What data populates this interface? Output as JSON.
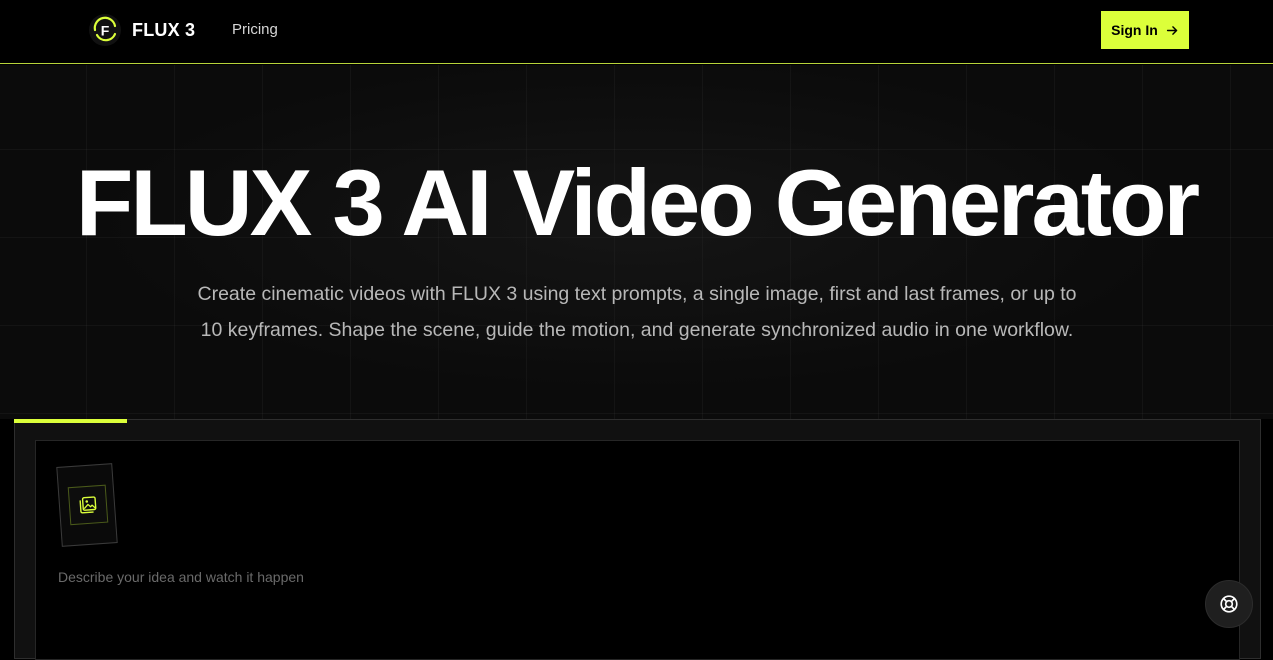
{
  "header": {
    "brand": "FLUX 3",
    "logo_letter": "F",
    "nav": {
      "pricing": "Pricing"
    },
    "signin_label": "Sign In"
  },
  "hero": {
    "title": "FLUX 3 AI Video Generator",
    "subtitle": "Create cinematic videos with FLUX 3 using text prompts, a single image, first and last frames, or up to 10 keyframes. Shape the scene, guide the motion, and generate synchronized audio in one workflow."
  },
  "composer": {
    "prompt_placeholder": "Describe your idea and watch it happen",
    "prompt_value": "",
    "upload_icon": "image-upload-icon"
  },
  "support": {
    "icon": "lifebuoy-icon"
  },
  "colors": {
    "accent": "#dcff3a",
    "background": "#000000",
    "hero_bg": "#0b0b0b",
    "panel_bg": "#111111",
    "text_muted": "#b8b8b8",
    "placeholder": "#6a6a6a"
  }
}
